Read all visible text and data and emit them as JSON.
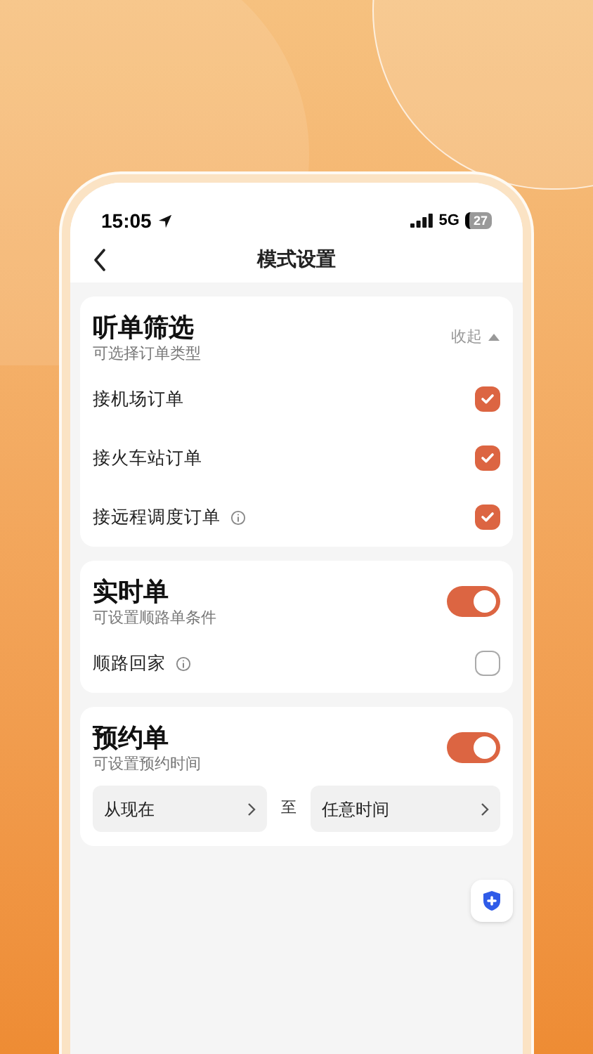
{
  "status_bar": {
    "time": "15:05",
    "network": "5G",
    "battery": "27"
  },
  "nav": {
    "title": "模式设置"
  },
  "sections": [
    {
      "title": "听单筛选",
      "subtitle": "可选择订单类型",
      "collapse_label": "收起",
      "options": [
        {
          "label": "接机场订单",
          "info": false,
          "checked": true
        },
        {
          "label": "接火车站订单",
          "info": false,
          "checked": true
        },
        {
          "label": "接远程调度订单",
          "info": true,
          "checked": true
        }
      ]
    },
    {
      "title": "实时单",
      "subtitle": "可设置顺路单条件",
      "on": true,
      "options": [
        {
          "label": "顺路回家",
          "info": true,
          "checked": false
        }
      ]
    },
    {
      "title": "预约单",
      "subtitle": "可设置预约时间",
      "on": true,
      "time_range": {
        "from": "从现在",
        "separator": "至",
        "to": "任意时间"
      }
    }
  ]
}
